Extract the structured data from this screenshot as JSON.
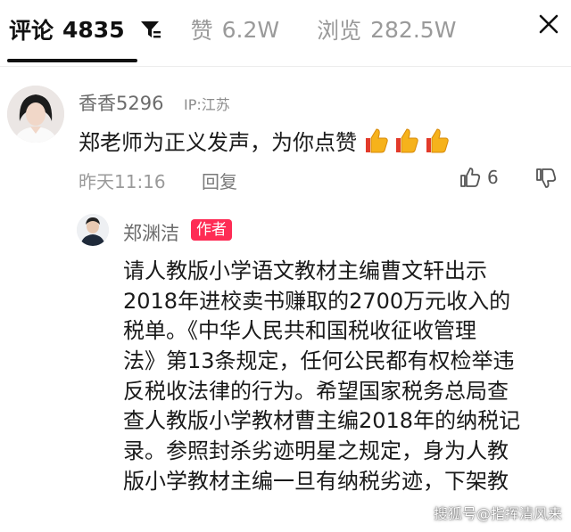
{
  "header": {
    "comments_label": "评论",
    "comments_count": "4835",
    "likes_label": "赞",
    "likes_count": "6.2W",
    "views_label": "浏览",
    "views_count": "282.5W"
  },
  "comments": [
    {
      "username": "香香5296",
      "ip": "IP:江苏",
      "text": "郑老师为正义发声，为你点赞",
      "time": "昨天11:16",
      "reply_label": "回复",
      "likes": "6"
    }
  ],
  "reply": {
    "username": "郑渊洁",
    "badge": "作者",
    "lines": [
      "请人教版小学语文教材主编曹文轩出示",
      "2018年进校卖书赚取的2700万元收入的",
      "税单。《中华人民共和国税收征收管理",
      "法》第13条规定，任何公民都有权检举违",
      "反税收法律的行为。希望国家税务总局查",
      "查人教版小学教材曹主编2018年的纳税记",
      "录。参照封杀劣迹明星之规定，身为人教",
      "版小学教材主编一旦有纳税劣迹，下架教"
    ]
  },
  "watermark": "搜狐号@指挥清风来",
  "colors": {
    "accent_badge": "#fe2c55",
    "thumb_emoji": "#f5a623"
  }
}
